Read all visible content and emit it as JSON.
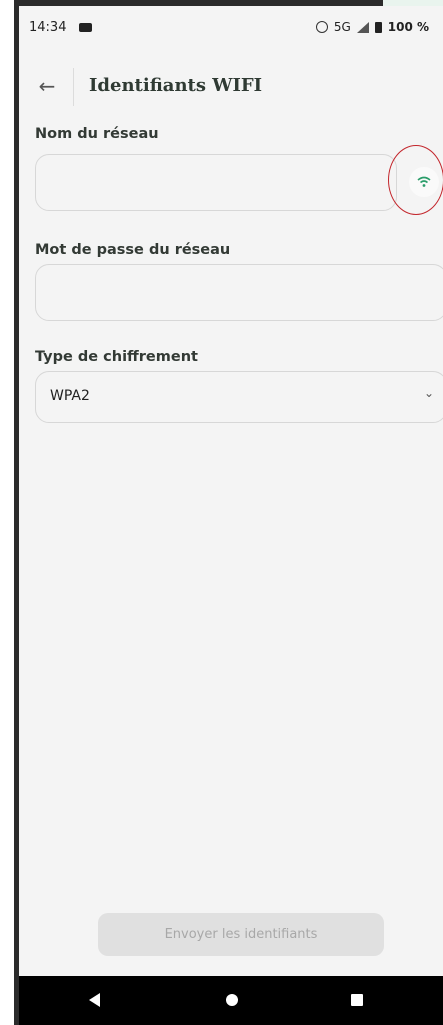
{
  "status_bar": {
    "time": "14:34",
    "network": "5G",
    "battery": "100 %"
  },
  "app_bar": {
    "back_icon": "arrow-left-icon",
    "title": "Identifiants WIFI"
  },
  "form": {
    "network_name": {
      "label": "Nom du réseau",
      "value": "",
      "wifi_button_icon": "wifi-icon"
    },
    "network_password": {
      "label": "Mot de passe du réseau",
      "value": ""
    },
    "encryption_type": {
      "label": "Type de chiffrement",
      "selected": "WPA2"
    },
    "submit_label": "Envoyer les identifiants"
  },
  "nav_bar": {
    "icons": [
      "back-triangle-icon",
      "home-circle-icon",
      "recents-square-icon"
    ]
  },
  "colors": {
    "accent": "#2a9d6a",
    "highlight": "#c3262c",
    "background": "#f4f4f4",
    "button_disabled": "#e0e0e0"
  }
}
